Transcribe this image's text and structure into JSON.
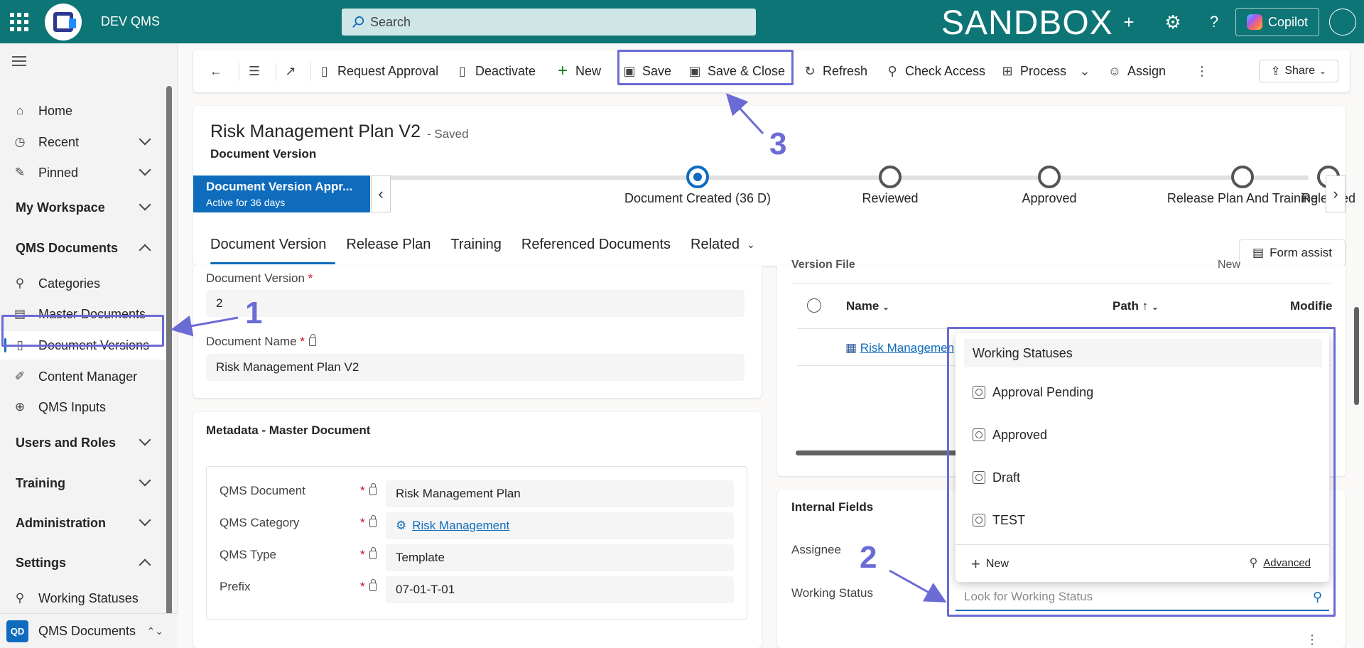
{
  "topbar": {
    "app_name": "DEV QMS",
    "search_placeholder": "Search",
    "environment_label": "SANDBOX",
    "copilot_label": "Copilot",
    "brand_color": "#0d7575"
  },
  "sidebar": {
    "items": [
      {
        "label": "Home",
        "icon": "home-icon"
      },
      {
        "label": "Recent",
        "icon": "clock-icon"
      },
      {
        "label": "Pinned",
        "icon": "pin-icon"
      },
      {
        "label": "My Workspace",
        "group": true
      },
      {
        "label": "QMS Documents",
        "group": true
      },
      {
        "label": "Categories",
        "icon": "hierarchy-icon"
      },
      {
        "label": "Master Documents",
        "icon": "documents-icon"
      },
      {
        "label": "Document Versions",
        "icon": "document-icon",
        "active": true
      },
      {
        "label": "Content Manager",
        "icon": "edit-document-icon"
      },
      {
        "label": "QMS Inputs",
        "icon": "globe-document-icon"
      },
      {
        "label": "Users and Roles",
        "group": true
      },
      {
        "label": "Training",
        "group": true
      },
      {
        "label": "Administration",
        "group": true
      },
      {
        "label": "Settings",
        "group": true
      },
      {
        "label": "Working Statuses",
        "icon": "hierarchy-icon"
      }
    ],
    "area": {
      "badge": "QD",
      "label": "QMS Documents"
    }
  },
  "commandbar": {
    "request_approval": "Request Approval",
    "deactivate": "Deactivate",
    "new": "New",
    "save": "Save",
    "save_close": "Save & Close",
    "refresh": "Refresh",
    "check_access": "Check Access",
    "process": "Process",
    "assign": "Assign",
    "share": "Share"
  },
  "record": {
    "title": "Risk Management Plan V2",
    "status": "- Saved",
    "entity": "Document Version"
  },
  "bpf": {
    "active_stage_name": "Document Version Appr...",
    "active_stage_sub": "Active for 36 days",
    "stages": [
      {
        "label": "Document Created  (36 D)",
        "current": true
      },
      {
        "label": "Reviewed"
      },
      {
        "label": "Approved"
      },
      {
        "label": "Release Plan And Training"
      },
      {
        "label": "Released"
      }
    ]
  },
  "tabs": [
    "Document Version",
    "Release Plan",
    "Training",
    "Referenced Documents",
    "Related"
  ],
  "form_assist": "Form assist",
  "general": {
    "doc_version_label": "Document Version",
    "doc_version_value": "2",
    "doc_name_label": "Document Name",
    "doc_name_value": "Risk Management Plan V2"
  },
  "metadata": {
    "title": "Metadata - Master Document",
    "fields": [
      {
        "label": "QMS Document",
        "value": "Risk Management Plan"
      },
      {
        "label": "QMS Category",
        "value": "Risk Management",
        "link": true
      },
      {
        "label": "QMS Type",
        "value": "Template"
      },
      {
        "label": "Prefix",
        "value": "07-01-T-01"
      }
    ]
  },
  "version_file": {
    "title": "Version File",
    "new_label": "New",
    "columns": [
      "Name",
      "Path",
      "Modifie"
    ],
    "row_name": "Risk Managemen"
  },
  "internal": {
    "title": "Internal Fields",
    "assignee_label": "Assignee",
    "working_status_label": "Working Status",
    "lookup_placeholder": "Look for Working Status"
  },
  "dropdown": {
    "header": "Working Statuses",
    "items": [
      "Approval Pending",
      "Approved",
      "Draft",
      "TEST"
    ],
    "new_label": "New",
    "advanced_label": "Advanced"
  },
  "annotations": {
    "one": "1",
    "two": "2",
    "three": "3",
    "color": "#6b6bd6"
  }
}
